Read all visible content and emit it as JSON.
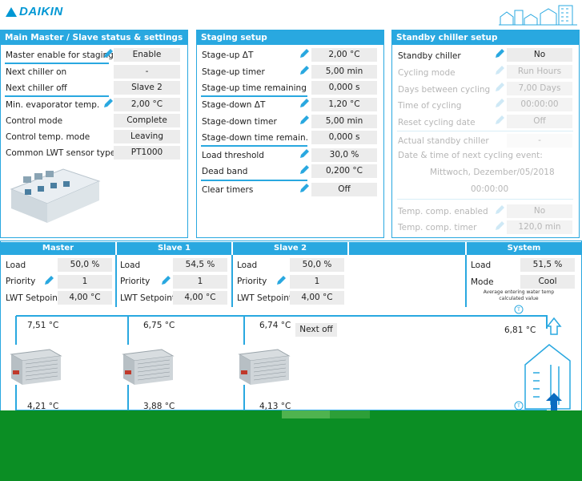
{
  "brand": "DAIKIN",
  "colors": {
    "accent": "#29a8e0",
    "bottom_bar": "#0b8e24"
  },
  "main_panel": {
    "title": "Main Master / Slave status & settings",
    "rows": [
      {
        "label": "Master enable for staging",
        "value": "Enable"
      },
      {
        "label": "Next chiller on",
        "value": "-"
      },
      {
        "label": "Next chiller off",
        "value": "Slave 2"
      },
      {
        "label": "Min. evaporator temp.",
        "value": "2,00 °C"
      },
      {
        "label": "Control mode",
        "value": "Complete"
      },
      {
        "label": "Control temp. mode",
        "value": "Leaving"
      },
      {
        "label": "Common LWT sensor type",
        "value": "PT1000"
      }
    ]
  },
  "staging_panel": {
    "title": "Staging setup",
    "rows": [
      {
        "label": "Stage-up ΔT",
        "value": "2,00 °C"
      },
      {
        "label": "Stage-up timer",
        "value": "5,00 min"
      },
      {
        "label": "Stage-up time remaining",
        "value": "0,000 s"
      },
      {
        "label": "Stage-down ΔT",
        "value": "1,20 °C"
      },
      {
        "label": "Stage-down timer",
        "value": "5,00 min"
      },
      {
        "label": "Stage-down time remain.",
        "value": "0,000 s"
      },
      {
        "label": "Load threshold",
        "value": "30,0 %"
      },
      {
        "label": "Dead band",
        "value": "0,200 °C"
      },
      {
        "label": "Clear timers",
        "value": "Off"
      }
    ]
  },
  "standby_panel": {
    "title": "Standby chiller setup",
    "rows": [
      {
        "label": "Standby chiller",
        "value": "No"
      },
      {
        "label": "Cycling mode",
        "value": "Run Hours"
      },
      {
        "label": "Days between cycling",
        "value": "7,00 Days"
      },
      {
        "label": "Time of cycling",
        "value": "00:00:00"
      },
      {
        "label": "Reset cycling date",
        "value": "Off"
      },
      {
        "label": "Actual standby chiller",
        "value": "-"
      }
    ],
    "next_cycling_label": "Date & time of next cycling event:",
    "next_cycling_date": "Mittwoch, Dezember/05/2018",
    "next_cycling_time": "00:00:00",
    "temp_comp_enabled_label": "Temp. comp. enabled",
    "temp_comp_enabled_value": "No",
    "temp_comp_timer_label": "Temp. comp. timer",
    "temp_comp_timer_value": "120,0 min"
  },
  "units": [
    {
      "name": "Master",
      "load_label": "Load",
      "load": "50,0 %",
      "priority_label": "Priority",
      "priority": "1",
      "lwt_label": "LWT Setpoint",
      "lwt": "4,00 °C",
      "temp_in": "7,51 °C",
      "temp_out": "4,21 °C",
      "status": ""
    },
    {
      "name": "Slave 1",
      "load_label": "Load",
      "load": "54,5 %",
      "priority_label": "Priority",
      "priority": "1",
      "lwt_label": "LWT Setpoint",
      "lwt": "4,00 °C",
      "temp_in": "6,75 °C",
      "temp_out": "3,88 °C",
      "status": ""
    },
    {
      "name": "Slave 2",
      "load_label": "Load",
      "load": "50,0 %",
      "priority_label": "Priority",
      "priority": "1",
      "lwt_label": "LWT Setpoint",
      "lwt": "4,00 °C",
      "temp_in": "6,74 °C",
      "temp_out": "4,13 °C",
      "status": "Next off"
    }
  ],
  "system": {
    "name": "System",
    "load_label": "Load",
    "load": "51,5 %",
    "mode_label": "Mode",
    "mode": "Cool",
    "avg_note": "Average entering water temp calculated value",
    "avg_temp": "6,81 °C"
  }
}
